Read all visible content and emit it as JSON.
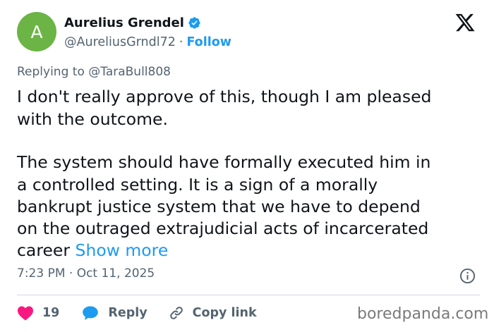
{
  "author": {
    "avatar_letter": "A",
    "avatar_color": "#6bb445",
    "name": "Aurelius Grendel",
    "verified": true,
    "handle": "@AureliusGrndl72",
    "separator": "·",
    "follow_label": "Follow"
  },
  "reply": {
    "prefix": "Replying to",
    "mention": "@TaraBull808"
  },
  "tweet": {
    "lines": [
      "I don't really approve of this, though I am pleased",
      "with the outcome.",
      "The system should have formally executed him in",
      "a controlled setting. It is a sign of a morally",
      "bankrupt justice system that we have to depend",
      "on the outraged extrajudicial acts of incarcerated",
      "career"
    ],
    "show_more": "Show more",
    "timestamp": "7:23 PM · Oct 11, 2025"
  },
  "actions": {
    "like_count": "19",
    "reply_label": "Reply",
    "copy_link_label": "Copy link"
  },
  "watermark": "boredpanda.com",
  "icons": [
    "x-logo-icon",
    "verified-badge-icon",
    "info-icon",
    "heart-icon",
    "reply-bubble-icon",
    "link-icon"
  ],
  "colors": {
    "accent": "#1d9bf0",
    "like": "#f91880",
    "secondary_text": "#536471"
  }
}
